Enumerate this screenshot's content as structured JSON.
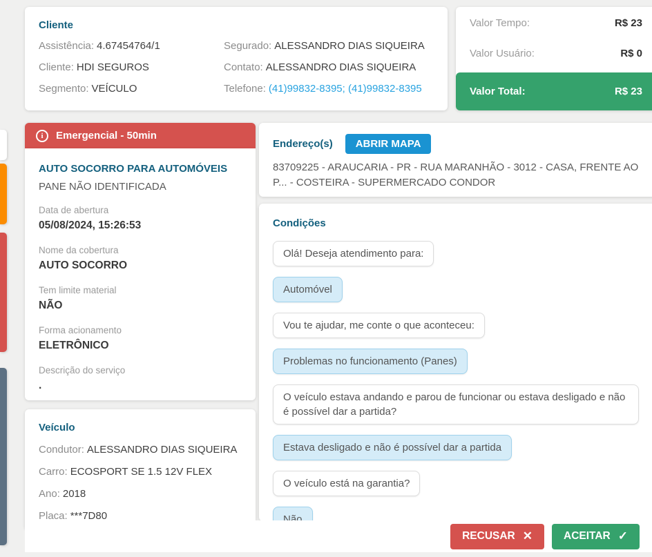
{
  "client_card": {
    "title": "Cliente",
    "fields_left": [
      {
        "label": "Assistência:",
        "value": "4.67454764/1"
      },
      {
        "label": "Cliente:",
        "value": "HDI SEGUROS"
      },
      {
        "label": "Segmento:",
        "value": "VEÍCULO"
      }
    ],
    "fields_right": [
      {
        "label": "Segurado:",
        "value": "ALESSANDRO DIAS SIQUEIRA"
      },
      {
        "label": "Contato:",
        "value": "ALESSANDRO DIAS SIQUEIRA"
      },
      {
        "label": "Telefone:",
        "value": "(41)99832-8395; (41)99832-8395"
      }
    ]
  },
  "values_card": {
    "rows": [
      {
        "label": "Valor Tempo:",
        "value": "R$ 23"
      },
      {
        "label": "Valor Usuário:",
        "value": "R$ 0"
      }
    ],
    "total": {
      "label": "Valor Total:",
      "value": "R$ 23"
    }
  },
  "service": {
    "priority_banner": "Emergencial - 50min",
    "title": "AUTO SOCORRO PARA AUTOMÓVEIS",
    "subtitle": "PANE NÃO IDENTIFICADA",
    "details": [
      {
        "label": "Data de abertura",
        "value": "05/08/2024, 15:26:53"
      },
      {
        "label": "Nome da cobertura",
        "value": "AUTO SOCORRO"
      },
      {
        "label": "Tem limite material",
        "value": "NÃO"
      },
      {
        "label": "Forma acionamento",
        "value": "ELETRÔNICO"
      },
      {
        "label": "Descrição do serviço",
        "value": "."
      }
    ]
  },
  "vehicle_card": {
    "title": "Veículo",
    "fields": [
      {
        "label": "Condutor:",
        "value": "ALESSANDRO DIAS SIQUEIRA"
      },
      {
        "label": "Carro:",
        "value": "ECOSPORT SE 1.5 12V FLEX"
      },
      {
        "label": "Ano:",
        "value": "2018"
      },
      {
        "label": "Placa:",
        "value": "***7D80"
      }
    ]
  },
  "address_card": {
    "title": "Endereço(s)",
    "map_button": "ABRIR MAPA",
    "address": "83709225 - ARAUCARIA - PR - RUA MARANHÃO - 3012 - CASA, FRENTE AO P... - COSTEIRA - SUPERMERCADO CONDOR"
  },
  "conditions_card": {
    "title": "Condições",
    "messages": [
      {
        "type": "question",
        "text": "Olá! Deseja atendimento para:"
      },
      {
        "type": "answer",
        "text": "Automóvel"
      },
      {
        "type": "question",
        "text": "Vou te ajudar, me conte o que aconteceu:"
      },
      {
        "type": "answer",
        "text": "Problemas no funcionamento (Panes)"
      },
      {
        "type": "question",
        "text": "O veículo estava andando e parou de funcionar ou estava desligado e não é possível dar a partida?"
      },
      {
        "type": "answer",
        "text": "Estava desligado e não é possível dar a partida"
      },
      {
        "type": "question",
        "text": "O veículo está na garantia?"
      },
      {
        "type": "answer",
        "text": "Não"
      }
    ]
  },
  "footer": {
    "reject_label": "RECUSAR",
    "accept_label": "ACEITAR"
  },
  "colors": {
    "accent_blue": "#1a93d2",
    "heading_blue": "#14607e",
    "danger_red": "#d5524e",
    "success_green": "#35a26c",
    "bubble_blue_bg": "#d5ecf8",
    "peek_orange": "#fb8c00",
    "peek_slate": "#5d7183",
    "link_blue": "#29a3e0"
  }
}
